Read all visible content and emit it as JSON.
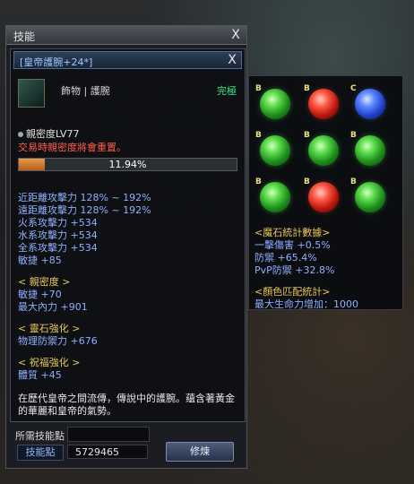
{
  "window": {
    "title": "技能"
  },
  "tooltip": {
    "name": "[皇帝護腕+24*]",
    "item_type": "飾物 | 護腕",
    "grade": "完極",
    "requirement": "親密度LV77",
    "warning": "交易時親密度將會重置。",
    "progress_percent": 11.94,
    "progress_text": "11.94%",
    "base_stats": [
      "近距離攻擊力 128% ~ 192%",
      "遠距離攻擊力 128% ~ 192%",
      "火系攻擊力 +534",
      "水系攻擊力 +534",
      "全系攻擊力 +534",
      "敏捷 +85"
    ],
    "sections": [
      {
        "title": "< 親密度 >",
        "stats": [
          "敏捷 +70",
          "最大內力 +901"
        ]
      },
      {
        "title": "< 靈石強化 >",
        "stats": [
          "物理防禦力 +676"
        ]
      },
      {
        "title": "< 祝福強化 >",
        "stats": [
          "體質 +45"
        ]
      }
    ],
    "description": "在歷代皇帝之間流傳，傳說中的護腕。蘊含著黃金的華麗和皇帝的氣勢。"
  },
  "gems": {
    "grid": [
      {
        "color": "green",
        "tag": "B"
      },
      {
        "color": "red",
        "tag": "B"
      },
      {
        "color": "blue",
        "tag": "C"
      },
      {
        "color": "green",
        "tag": "B"
      },
      {
        "color": "green",
        "tag": "B"
      },
      {
        "color": "green",
        "tag": "B"
      },
      {
        "color": "green",
        "tag": "B"
      },
      {
        "color": "red",
        "tag": "B"
      },
      {
        "color": "green",
        "tag": "B"
      }
    ],
    "stats_title": "<魔石統計數據>",
    "stats": [
      "一擊傷害 +0.5%",
      "防禦 +65.4%",
      "PvP防禦 +32.8%"
    ],
    "match_title": "<顏色匹配統計>",
    "match_stats": [
      "最大生命力增加：1000"
    ]
  },
  "footer": {
    "required_points_label": "所需技能點",
    "skill_points_label": "技能點",
    "skill_points_value": "5729465",
    "train_label": "修煉"
  }
}
